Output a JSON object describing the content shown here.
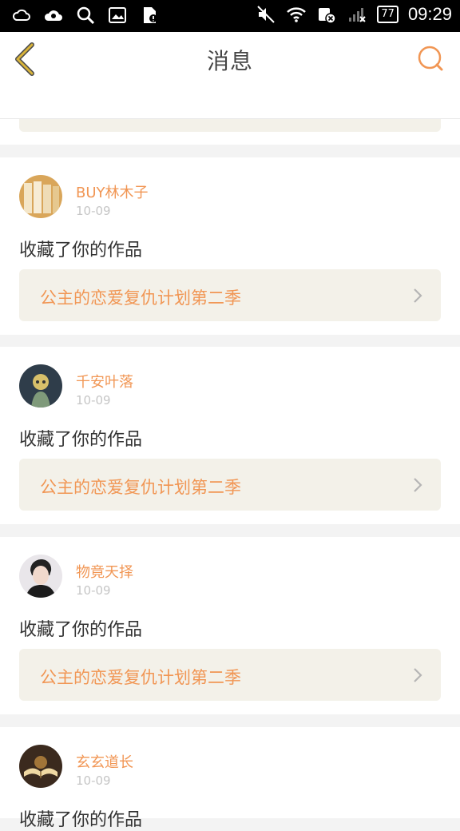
{
  "status_bar": {
    "time": "09:29",
    "battery": "77"
  },
  "header": {
    "title": "消息"
  },
  "messages": [
    {
      "user": "BUY林木子",
      "date": "10-09",
      "action": "收藏了你的作品",
      "work": "公主的恋爱复仇计划第二季"
    },
    {
      "user": "千安叶落",
      "date": "10-09",
      "action": "收藏了你的作品",
      "work": "公主的恋爱复仇计划第二季"
    },
    {
      "user": "物竟天择",
      "date": "10-09",
      "action": "收藏了你的作品",
      "work": "公主的恋爱复仇计划第二季"
    },
    {
      "user": "玄玄道长",
      "date": "10-09",
      "action": "收藏了你的作品"
    }
  ],
  "colors": {
    "accent": "#f19654",
    "work_bg": "#f3f1e9",
    "back_icon": "#d9b43a"
  }
}
